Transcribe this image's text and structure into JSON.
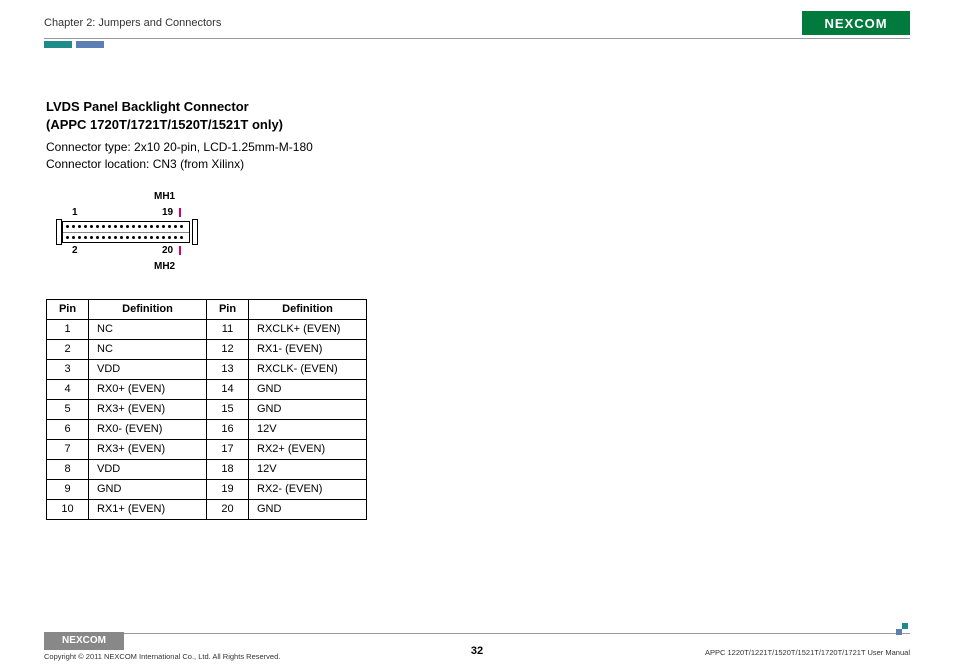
{
  "header": {
    "chapter": "Chapter 2: Jumpers and Connectors",
    "logo_text": "NEXCOM"
  },
  "section": {
    "title_l1": "LVDS Panel Backlight Connector",
    "title_l2": "(APPC 1720T/1721T/1520T/1521T only)",
    "desc_l1": "Connector type: 2x10 20-pin, LCD-1.25mm-M-180",
    "desc_l2": "Connector location: CN3 (from Xilinx)"
  },
  "diagram": {
    "mh1": "MH1",
    "mh2": "MH2",
    "p1": "1",
    "p2": "2",
    "p19": "19",
    "p20": "20"
  },
  "table": {
    "head_pin": "Pin",
    "head_def": "Definition",
    "rows": [
      {
        "p1": "1",
        "d1": "NC",
        "p2": "11",
        "d2": "RXCLK+ (EVEN)"
      },
      {
        "p1": "2",
        "d1": "NC",
        "p2": "12",
        "d2": "RX1- (EVEN)"
      },
      {
        "p1": "3",
        "d1": "VDD",
        "p2": "13",
        "d2": "RXCLK- (EVEN)"
      },
      {
        "p1": "4",
        "d1": "RX0+ (EVEN)",
        "p2": "14",
        "d2": "GND"
      },
      {
        "p1": "5",
        "d1": "RX3+ (EVEN)",
        "p2": "15",
        "d2": "GND"
      },
      {
        "p1": "6",
        "d1": "RX0- (EVEN)",
        "p2": "16",
        "d2": "12V"
      },
      {
        "p1": "7",
        "d1": "RX3+ (EVEN)",
        "p2": "17",
        "d2": "RX2+ (EVEN)"
      },
      {
        "p1": "8",
        "d1": "VDD",
        "p2": "18",
        "d2": "12V"
      },
      {
        "p1": "9",
        "d1": "GND",
        "p2": "19",
        "d2": "RX2- (EVEN)"
      },
      {
        "p1": "10",
        "d1": "RX1+ (EVEN)",
        "p2": "20",
        "d2": "GND"
      }
    ]
  },
  "footer": {
    "logo_text": "NEXCOM",
    "copyright": "Copyright © 2011 NEXCOM International Co., Ltd. All Rights Reserved.",
    "page_number": "32",
    "manual": "APPC 1220T/1221T/1520T/1521T/1720T/1721T User Manual"
  }
}
